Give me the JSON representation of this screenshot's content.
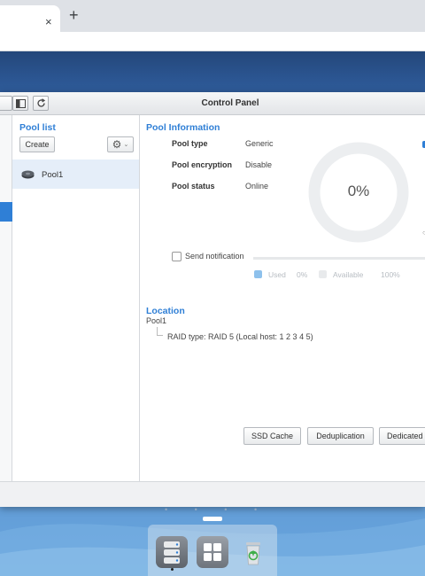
{
  "browser": {
    "tab_close_glyph": "×",
    "new_tab_glyph": "+"
  },
  "window": {
    "title": "Control Panel",
    "toolbar_icons": [
      "panel-toggle-icon",
      "refresh-icon"
    ]
  },
  "pool_list": {
    "title": "Pool list",
    "create_label": "Create",
    "settings_icon": "gear-icon",
    "items": [
      {
        "name": "Pool1",
        "icon": "disk-icon",
        "selected": true
      }
    ]
  },
  "pool_info": {
    "title": "Pool Information",
    "rows": [
      {
        "label": "Pool type",
        "value": "Generic"
      },
      {
        "label": "Pool encryption",
        "value": "Disable"
      },
      {
        "label": "Pool status",
        "value": "Online"
      }
    ],
    "usage_percent_text": "0%",
    "usage_fraction": 0.0,
    "send_notification_label": "Send notification",
    "send_notification_checked": false,
    "legend": {
      "used_label": "Used",
      "used_value": "0%",
      "used_color": "#8ec1ec",
      "available_label": "Available",
      "available_value": "100%",
      "available_color": "#e8eaec"
    }
  },
  "location": {
    "title": "Location",
    "pool_name": "Pool1",
    "raid_text": "RAID type: RAID 5 (Local host: 1 2 3 4 5)"
  },
  "actions": {
    "ssd_cache_label": "SSD Cache",
    "deduplication_label": "Deduplication",
    "dedicated_label": "Dedicated"
  },
  "dock": {
    "apps": [
      "storage-manager-icon",
      "apps-grid-icon",
      "recycle-bin-icon"
    ]
  },
  "colors": {
    "accent": "#2f7fd6",
    "selected_row": "#e5eef9"
  }
}
